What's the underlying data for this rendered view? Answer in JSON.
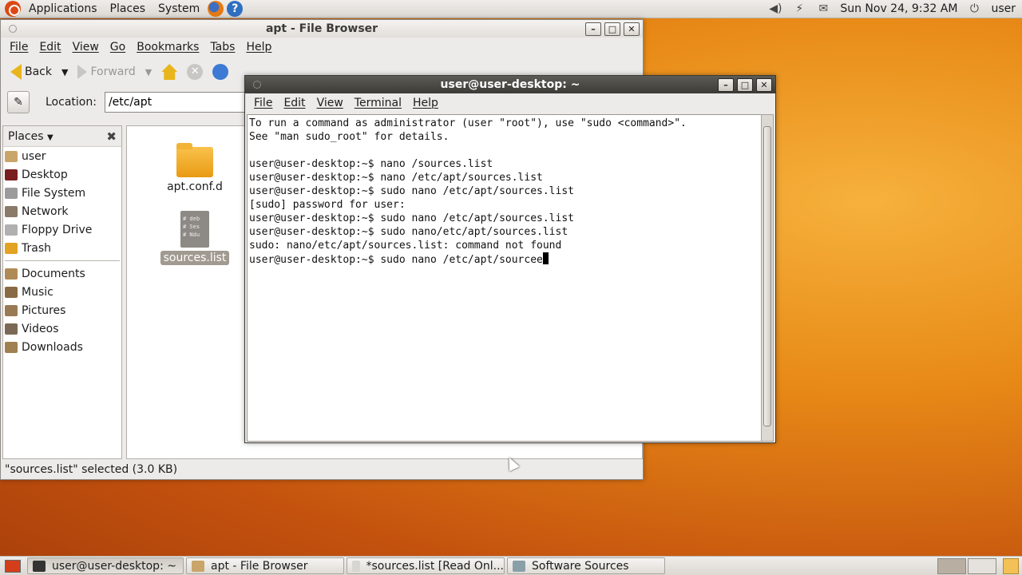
{
  "top_panel": {
    "menus": [
      "Applications",
      "Places",
      "System"
    ],
    "clock": "Sun Nov 24,  9:32 AM",
    "user": "user"
  },
  "file_browser": {
    "title": "apt - File Browser",
    "menu": [
      "File",
      "Edit",
      "View",
      "Go",
      "Bookmarks",
      "Tabs",
      "Help"
    ],
    "toolbar": {
      "back": "Back",
      "forward": "Forward"
    },
    "location_label": "Location:",
    "location_value": "/etc/apt",
    "sidebar_title": "Places",
    "places": [
      {
        "label": "user",
        "color": "#c9a56a"
      },
      {
        "label": "Desktop",
        "color": "#7a1f1f"
      },
      {
        "label": "File System",
        "color": "#9b9b9b"
      },
      {
        "label": "Network",
        "color": "#8a7a6a"
      },
      {
        "label": "Floppy Drive",
        "color": "#b0b0b0"
      },
      {
        "label": "Trash",
        "color": "#e2a224"
      }
    ],
    "bookmarks": [
      {
        "label": "Documents",
        "color": "#b08a55"
      },
      {
        "label": "Music",
        "color": "#8a6a45"
      },
      {
        "label": "Pictures",
        "color": "#9a7a55"
      },
      {
        "label": "Videos",
        "color": "#7a6a55"
      },
      {
        "label": "Downloads",
        "color": "#a08050"
      }
    ],
    "files": [
      {
        "name": "apt.conf.d",
        "type": "folder"
      },
      {
        "name": "sources.list",
        "type": "text",
        "preview": [
          "# deb",
          "# Ses",
          "# Ndu"
        ]
      }
    ],
    "status": "\"sources.list\" selected (3.0 KB)"
  },
  "terminal": {
    "title": "user@user-desktop: ~",
    "menu": [
      "File",
      "Edit",
      "View",
      "Terminal",
      "Help"
    ],
    "lines": [
      "To run a command as administrator (user \"root\"), use \"sudo <command>\".",
      "See \"man sudo_root\" for details.",
      "",
      "user@user-desktop:~$ nano /sources.list",
      "user@user-desktop:~$ nano /etc/apt/sources.list",
      "user@user-desktop:~$ sudo nano /etc/apt/sources.list",
      "[sudo] password for user:",
      "user@user-desktop:~$ sudo nano /etc/apt/sources.list",
      "user@user-desktop:~$ sudo nano/etc/apt/sources.list",
      "sudo: nano/etc/apt/sources.list: command not found",
      "user@user-desktop:~$ sudo nano /etc/apt/sourcee"
    ]
  },
  "taskbar": [
    {
      "label": "user@user-desktop: ~",
      "color": "#333333",
      "active": true
    },
    {
      "label": "apt - File Browser",
      "color": "#c9a56a",
      "active": false
    },
    {
      "label": "*sources.list [Read Onl...",
      "color": "#d8d6d2",
      "active": false
    },
    {
      "label": "Software Sources",
      "color": "#8aa0a8",
      "active": false
    }
  ]
}
